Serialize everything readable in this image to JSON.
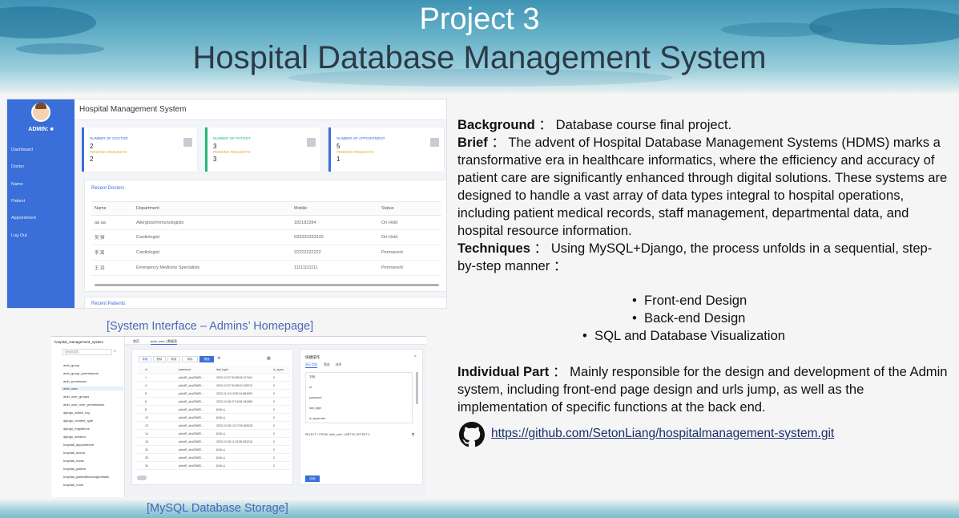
{
  "slide": {
    "title": "Project 3",
    "subtitle": "Hospital Database Management System"
  },
  "admin_ui": {
    "header_title": "Hospital Management System",
    "admin_label": "ADMIN: ■",
    "sidebar": [
      "Dashboard",
      "Doctor",
      "Name",
      "Patient",
      "Appointment",
      "Log Out"
    ],
    "stats": [
      {
        "label": "NUMBER OF DOCTOR",
        "value": "2",
        "pending_label": "PENDING REQUESTS",
        "pending_value": "2"
      },
      {
        "label": "NUMBER OF PATIENT",
        "value": "3",
        "pending_label": "PENDING REQUESTS",
        "pending_value": "3"
      },
      {
        "label": "NUMBER OF APPOINTMENT",
        "value": "5",
        "pending_label": "PENDING REQUESTS",
        "pending_value": "1"
      }
    ],
    "recent_doctors_title": "Recent Doctors",
    "columns": [
      "Name",
      "Department",
      "Mobile",
      "Status"
    ],
    "rows": [
      [
        "aa aa",
        "Allergists/Immunologists",
        "182182284",
        "On Hold"
      ],
      [
        "吴 狮",
        "Cardiologist",
        "033333333333",
        "On Hold"
      ],
      [
        "李 嵩",
        "Cardiologist",
        "22222222222",
        "Permanent"
      ],
      [
        "王 润",
        "Emergency Medicine Specialists",
        "11111111111",
        "Permanent"
      ]
    ],
    "recent_patients_title": "Recent Patients"
  },
  "captions": {
    "admin": "[System Interface – Admins’ Homepage]",
    "mysql": "[MySQL Database Storage]"
  },
  "mysql_ui": {
    "db_name": "hospital_management_system",
    "search_placeholder": "搜索数据表",
    "tables": [
      "auth_group",
      "auth_group_permissions",
      "auth_permission",
      "auth_user",
      "auth_user_groups",
      "auth_user_user_permissions",
      "django_admin_log",
      "django_content_type",
      "django_migrations",
      "django_session",
      "hospital_appointment",
      "hospital_doctor",
      "hospital_nurse",
      "hospital_patient",
      "hospital_patientdischargedetails",
      "hospital_room"
    ],
    "tabs": [
      "首页",
      "auth_user | 数据表"
    ],
    "toolbar": [
      "新增",
      "删除",
      "刷新",
      "清除",
      "筛选"
    ],
    "grid_columns": [
      "id",
      "password",
      "last_login",
      "is_super"
    ],
    "grid_rows": [
      [
        "1",
        "pbkdf2_sha256$3...",
        "2023-12-07 02:58:18.197161",
        "0"
      ],
      [
        "4",
        "pbkdf2_sha256$3...",
        "2023-12-07 02:58:19.125274",
        "0"
      ],
      [
        "5",
        "pbkdf2_sha256$3...",
        "2023-11-24 13:39:34.884339",
        "0"
      ],
      [
        "6",
        "pbkdf2_sha256$3...",
        "2023-12-06 07:16:54.340265",
        "0"
      ],
      [
        "8",
        "pbkdf2_sha256$3...",
        "(NULL)",
        "0"
      ],
      [
        "10",
        "pbkdf2_sha256$3...",
        "(NULL)",
        "0"
      ],
      [
        "13",
        "pbkdf2_sha256$3...",
        "2023-12-05 13:17:53.063028",
        "0"
      ],
      [
        "14",
        "pbkdf2_sha256$3...",
        "(NULL)",
        "0"
      ],
      [
        "15",
        "pbkdf2_sha256$3...",
        "2023-12-05 11:22:59.052218",
        "0"
      ],
      [
        "24",
        "pbkdf2_sha256$3...",
        "(NULL)",
        "0"
      ],
      [
        "25",
        "pbkdf2_sha256$3...",
        "(NULL)",
        "0"
      ],
      [
        "34",
        "pbkdf2_sha256$3...",
        "(NULL)",
        "0"
      ]
    ],
    "panel_title": "快捷操作",
    "panel_tabs": [
      "显示字段",
      "筛选",
      "排序"
    ],
    "panel_fields": [
      "字段",
      "id",
      "password",
      "last_login",
      "is_superuser"
    ],
    "sql": "SELECT * FROM `auth_user` LIMIT 50 OFFSET 0",
    "apply_label": "应用"
  },
  "content": {
    "background_label": "Background",
    "background_text": "： Database course final project.",
    "brief_label": "Brief",
    "brief_text": "：  The advent of Hospital Database Management Systems (HDMS) marks a transformative era in healthcare informatics, where the efficiency and accuracy of patient care are significantly enhanced through digital solutions. These systems are designed to handle a vast array of data types integral to hospital operations, including patient medical records, staff management, departmental data, and hospital resource information.",
    "techniques_label": "Techniques",
    "techniques_text": "： Using MySQL+Django, the process unfolds in a sequential, step-by-step manner ：",
    "bullets": [
      "Front-end Design",
      "Back-end Design",
      "SQL and Database Visualization"
    ],
    "individual_label": "Individual Part",
    "individual_text": "： Mainly responsible for the design and development of the Admin system, including front-end page design and urls jump, as well as the implementation of specific functions at the back end.",
    "github_url": "https://github.com/SetonLiang/hospitalmanagement-system.git"
  },
  "colors": {
    "sidebar": "#3a6fd9",
    "caption": "#4a68b5",
    "link": "#1a2f6e"
  }
}
